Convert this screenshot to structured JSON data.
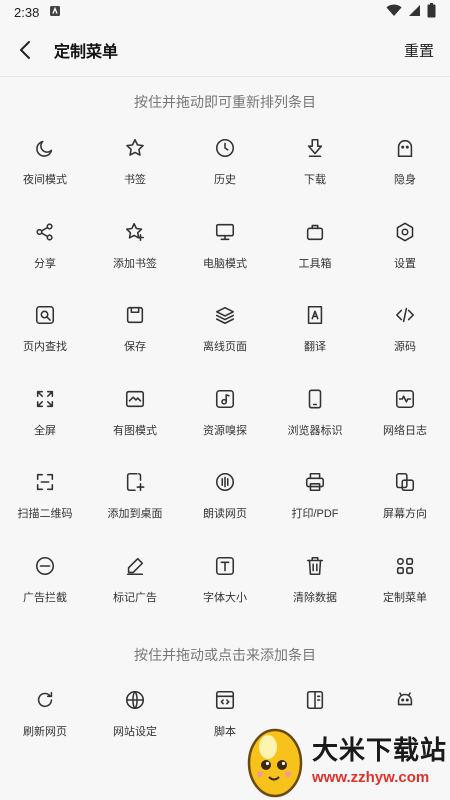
{
  "status_bar": {
    "time": "2:38"
  },
  "app_bar": {
    "title": "定制菜单",
    "reset_label": "重置"
  },
  "hint_active": "按住并拖动即可重新排列条目",
  "active_items": [
    {
      "label": "夜间模式",
      "icon": "moon-icon"
    },
    {
      "label": "书签",
      "icon": "star-icon"
    },
    {
      "label": "历史",
      "icon": "clock-icon"
    },
    {
      "label": "下载",
      "icon": "download-icon"
    },
    {
      "label": "隐身",
      "icon": "ghost-icon"
    },
    {
      "label": "分享",
      "icon": "share-icon"
    },
    {
      "label": "添加书签",
      "icon": "star-plus-icon"
    },
    {
      "label": "电脑模式",
      "icon": "monitor-icon"
    },
    {
      "label": "工具箱",
      "icon": "toolbox-icon"
    },
    {
      "label": "设置",
      "icon": "gear-icon"
    },
    {
      "label": "页内查找",
      "icon": "find-in-page-icon"
    },
    {
      "label": "保存",
      "icon": "save-icon"
    },
    {
      "label": "离线页面",
      "icon": "layers-icon"
    },
    {
      "label": "翻译",
      "icon": "translate-icon"
    },
    {
      "label": "源码",
      "icon": "code-icon"
    },
    {
      "label": "全屏",
      "icon": "fullscreen-icon"
    },
    {
      "label": "有图模式",
      "icon": "image-icon"
    },
    {
      "label": "资源嗅探",
      "icon": "music-icon"
    },
    {
      "label": "浏览器标识",
      "icon": "phone-icon"
    },
    {
      "label": "网络日志",
      "icon": "pulse-icon"
    },
    {
      "label": "扫描二维码",
      "icon": "scan-icon"
    },
    {
      "label": "添加到桌面",
      "icon": "add-to-desktop-icon"
    },
    {
      "label": "朗读网页",
      "icon": "read-aloud-icon"
    },
    {
      "label": "打印/PDF",
      "icon": "printer-icon"
    },
    {
      "label": "屏幕方向",
      "icon": "rotate-screen-icon"
    },
    {
      "label": "广告拦截",
      "icon": "block-icon"
    },
    {
      "label": "标记广告",
      "icon": "pen-icon"
    },
    {
      "label": "字体大小",
      "icon": "font-size-icon"
    },
    {
      "label": "清除数据",
      "icon": "trash-icon"
    },
    {
      "label": "定制菜单",
      "icon": "grid-icon"
    }
  ],
  "hint_available": "按住并拖动或点击来添加条目",
  "available_items": [
    {
      "label": "刷新网页",
      "icon": "refresh-icon"
    },
    {
      "label": "网站设定",
      "icon": "globe-icon"
    },
    {
      "label": "脚本",
      "icon": "script-icon"
    },
    {
      "label": "",
      "icon": "sidebar-icon"
    },
    {
      "label": "",
      "icon": "android-icon"
    }
  ],
  "watermark": {
    "title": "大米下载站",
    "url": "www.zzhyw.com"
  }
}
